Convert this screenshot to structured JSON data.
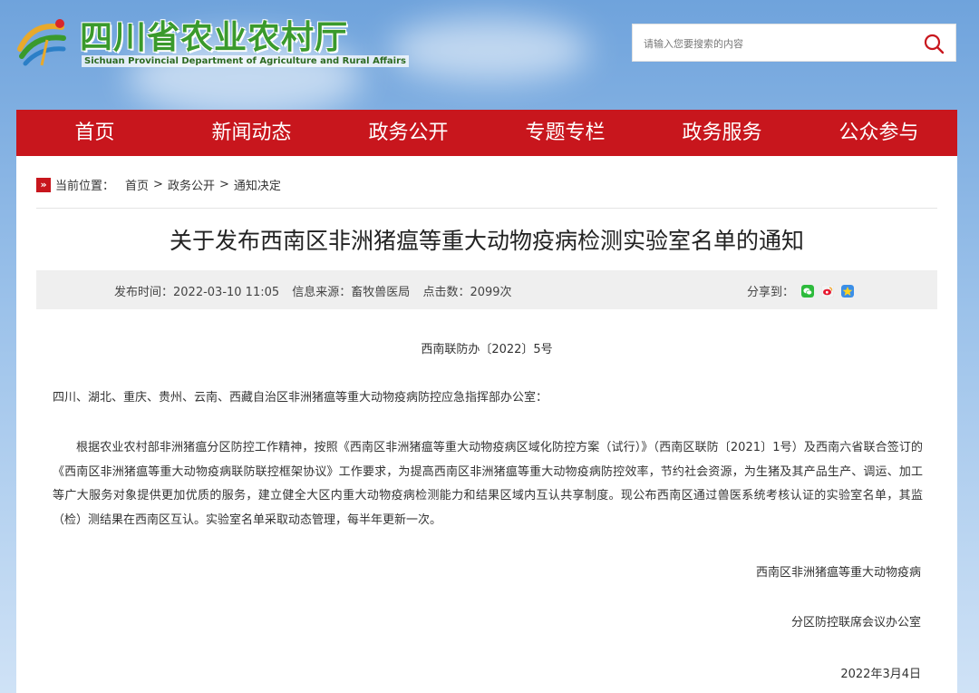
{
  "header": {
    "logo_cn": "四川省农业农村厅",
    "logo_en": "Sichuan Provincial Department of Agriculture and Rural Affairs",
    "search_placeholder": "请输入您要搜索的内容"
  },
  "nav": {
    "items": [
      "首页",
      "新闻动态",
      "政务公开",
      "专题专栏",
      "政务服务",
      "公众参与"
    ]
  },
  "breadcrumb": {
    "label": "当前位置：",
    "items": [
      "首页",
      "政务公开",
      "通知决定"
    ],
    "separator": ">"
  },
  "article": {
    "title": "关于发布西南区非洲猪瘟等重大动物疫病检测实验室名单的通知",
    "publish_time": "发布时间：2022-03-10 11:05",
    "source": "信息来源：畜牧兽医局",
    "clicks": "点击数：2099次",
    "share_label": "分享到：",
    "doc_number": "西南联防办〔2022〕5号",
    "addressee": "四川、湖北、重庆、贵州、云南、西藏自治区非洲猪瘟等重大动物疫病防控应急指挥部办公室：",
    "body": "根据农业农村部非洲猪瘟分区防控工作精神，按照《西南区非洲猪瘟等重大动物疫病区域化防控方案（试行）》（西南区联防〔2021〕1号）及西南六省联合签订的《西南区非洲猪瘟等重大动物疫病联防联控框架协议》工作要求，为提高西南区非洲猪瘟等重大动物疫病防控效率，节约社会资源，为生猪及其产品生产、调运、加工等广大服务对象提供更加优质的服务，建立健全大区内重大动物疫病检测能力和结果区域内互认共享制度。现公布西南区通过兽医系统考核认证的实验室名单，其监（检）测结果在西南区互认。实验室名单采取动态管理，每半年更新一次。",
    "signature_line1": "西南区非洲猪瘟等重大动物疫病",
    "signature_line2": "分区防控联席会议办公室",
    "date": "2022年3月4日"
  },
  "colors": {
    "nav_red": "#c8161d",
    "logo_green": "#3a9a2c"
  }
}
